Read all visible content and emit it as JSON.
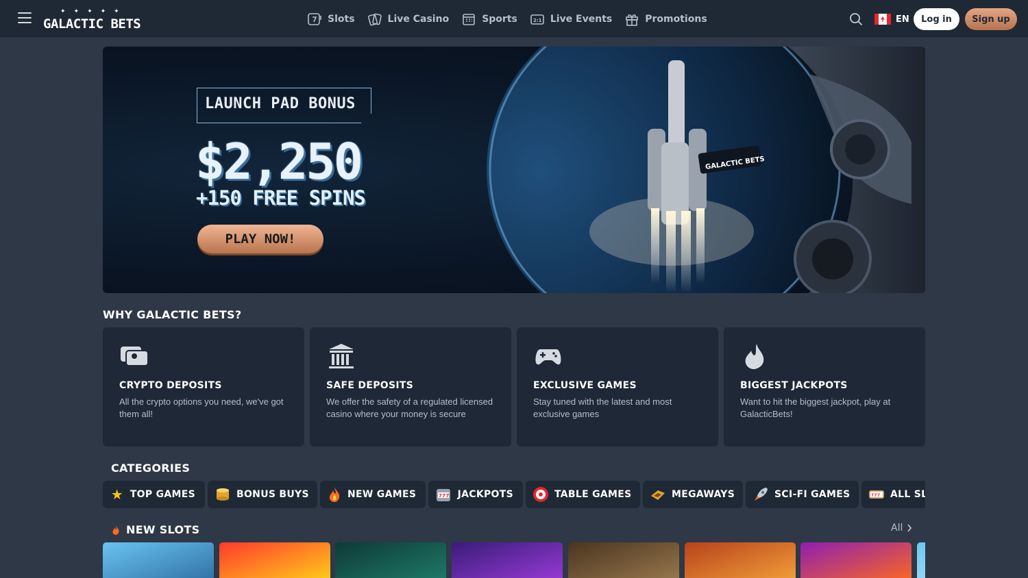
{
  "header": {
    "logo_text": "GALACTIC BETS",
    "logo_stars": "✦✦✦✦✦",
    "nav": [
      {
        "label": "Slots",
        "icon": "slot-machine-icon"
      },
      {
        "label": "Live Casino",
        "icon": "cards-icon"
      },
      {
        "label": "Sports",
        "icon": "scoreboard-icon"
      },
      {
        "label": "Live Events",
        "icon": "live-score-icon"
      },
      {
        "label": "Promotions",
        "icon": "gift-icon"
      }
    ],
    "language": "EN",
    "login_label": "Log in",
    "signup_label": "Sign up"
  },
  "hero": {
    "badge": "LAUNCH PAD BONUS",
    "amount": "$2,250",
    "spins": "+150 FREE SPINS",
    "cta": "PLAY NOW!",
    "art_logo": "GALACTIC BETS"
  },
  "why": {
    "title": "WHY GALACTIC BETS?",
    "features": [
      {
        "title": "CRYPTO DEPOSITS",
        "desc": "All the crypto options you need, we've got them all!",
        "icon": "wallet-icon"
      },
      {
        "title": "SAFE DEPOSITS",
        "desc": "We offer the safety of a regulated licensed casino where your money is secure",
        "icon": "bank-icon"
      },
      {
        "title": "EXCLUSIVE GAMES",
        "desc": "Stay tuned with the latest and most exclusive games",
        "icon": "gamepad-icon"
      },
      {
        "title": "BIGGEST JACKPOTS",
        "desc": "Want to hit the biggest jackpot, play at GalacticBets!",
        "icon": "flame-icon"
      }
    ]
  },
  "categories": {
    "title": "CATEGORIES",
    "items": [
      {
        "label": "TOP GAMES",
        "icon": "star-icon"
      },
      {
        "label": "BONUS BUYS",
        "icon": "coins-icon"
      },
      {
        "label": "NEW GAMES",
        "icon": "fire-icon"
      },
      {
        "label": "JACKPOTS",
        "icon": "slot-777-icon"
      },
      {
        "label": "TABLE GAMES",
        "icon": "roulette-icon"
      },
      {
        "label": "MEGAWAYS",
        "icon": "megaways-icon"
      },
      {
        "label": "SCI-FI GAMES",
        "icon": "rocket-icon"
      },
      {
        "label": "ALL SLOTS",
        "icon": "reels-icon"
      }
    ]
  },
  "new_slots": {
    "title": "NEW SLOTS",
    "all_label": "All",
    "tiles": [
      {
        "name": "slot-game-1",
        "color_a": "#69c3f0",
        "color_b": "#2f6fa3"
      },
      {
        "name": "slot-game-2",
        "color_a": "#ff3a2b",
        "color_b": "#ffd31a"
      },
      {
        "name": "slot-game-3",
        "color_a": "#0e3a36",
        "color_b": "#1f7c6a"
      },
      {
        "name": "slot-game-4",
        "color_a": "#3a1c7a",
        "color_b": "#9b3bd8"
      },
      {
        "name": "slot-game-5",
        "color_a": "#4a3520",
        "color_b": "#9a7a4e"
      },
      {
        "name": "slot-game-6",
        "color_a": "#b8421c",
        "color_b": "#f2a23a"
      },
      {
        "name": "slot-game-7",
        "color_a": "#8e1fb0",
        "color_b": "#ff6a1e"
      },
      {
        "name": "slot-game-8",
        "color_a": "#6ec8f0",
        "color_b": "#b8e4f8"
      }
    ]
  },
  "colors": {
    "page_bg": "#2e3846",
    "header_bg": "#1f2935",
    "card_bg": "#1e2836",
    "accent": "#d08a63"
  }
}
